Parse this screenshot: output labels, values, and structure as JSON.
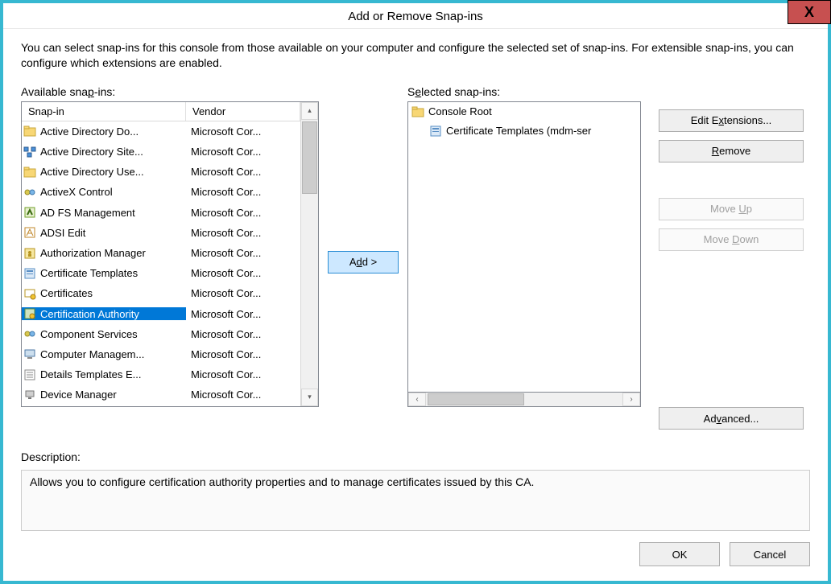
{
  "title": "Add or Remove Snap-ins",
  "close_x": "X",
  "intro": "You can select snap-ins for this console from those available on your computer and configure the selected set of snap-ins. For extensible snap-ins, you can configure which extensions are enabled.",
  "available_label_pre": "Available sna",
  "available_label_u": "p",
  "available_label_post": "-ins:",
  "selected_label_pre": "S",
  "selected_label_u": "e",
  "selected_label_post": "lected snap-ins:",
  "columns": {
    "snapin": "Snap-in",
    "vendor": "Vendor"
  },
  "vendor_default": "Microsoft Cor...",
  "snapins": [
    {
      "name": "Active Directory Do...",
      "icon": "folder-generic"
    },
    {
      "name": "Active Directory Site...",
      "icon": "sites"
    },
    {
      "name": "Active Directory Use...",
      "icon": "folder-generic"
    },
    {
      "name": "ActiveX Control",
      "icon": "component"
    },
    {
      "name": "AD FS Management",
      "icon": "adfs"
    },
    {
      "name": "ADSI Edit",
      "icon": "adsi"
    },
    {
      "name": "Authorization Manager",
      "icon": "authz"
    },
    {
      "name": "Certificate Templates",
      "icon": "cert-templates"
    },
    {
      "name": "Certificates",
      "icon": "cert"
    },
    {
      "name": "Certification Authority",
      "icon": "ca",
      "selected": true
    },
    {
      "name": "Component Services",
      "icon": "component"
    },
    {
      "name": "Computer Managem...",
      "icon": "computer"
    },
    {
      "name": "Details Templates E...",
      "icon": "details"
    },
    {
      "name": "Device Manager",
      "icon": "device"
    }
  ],
  "add_btn_pre": "A",
  "add_btn_u": "d",
  "add_btn_post": "d >",
  "tree": {
    "root": {
      "label": "Console Root",
      "icon": "folder"
    },
    "child": {
      "label": "Certificate Templates (mdm-ser",
      "icon": "cert-templates"
    }
  },
  "buttons": {
    "edit_ext_pre": "Edit E",
    "edit_ext_u": "x",
    "edit_ext_post": "tensions...",
    "remove_pre": "",
    "remove_u": "R",
    "remove_post": "emove",
    "moveup_pre": "Move ",
    "moveup_u": "U",
    "moveup_post": "p",
    "movedown_pre": "Move ",
    "movedown_u": "D",
    "movedown_post": "own",
    "advanced_pre": "Ad",
    "advanced_u": "v",
    "advanced_post": "anced..."
  },
  "description_label": "Description:",
  "description_text": "Allows you to configure certification authority  properties and to manage certificates issued by this CA.",
  "ok": "OK",
  "cancel": "Cancel"
}
